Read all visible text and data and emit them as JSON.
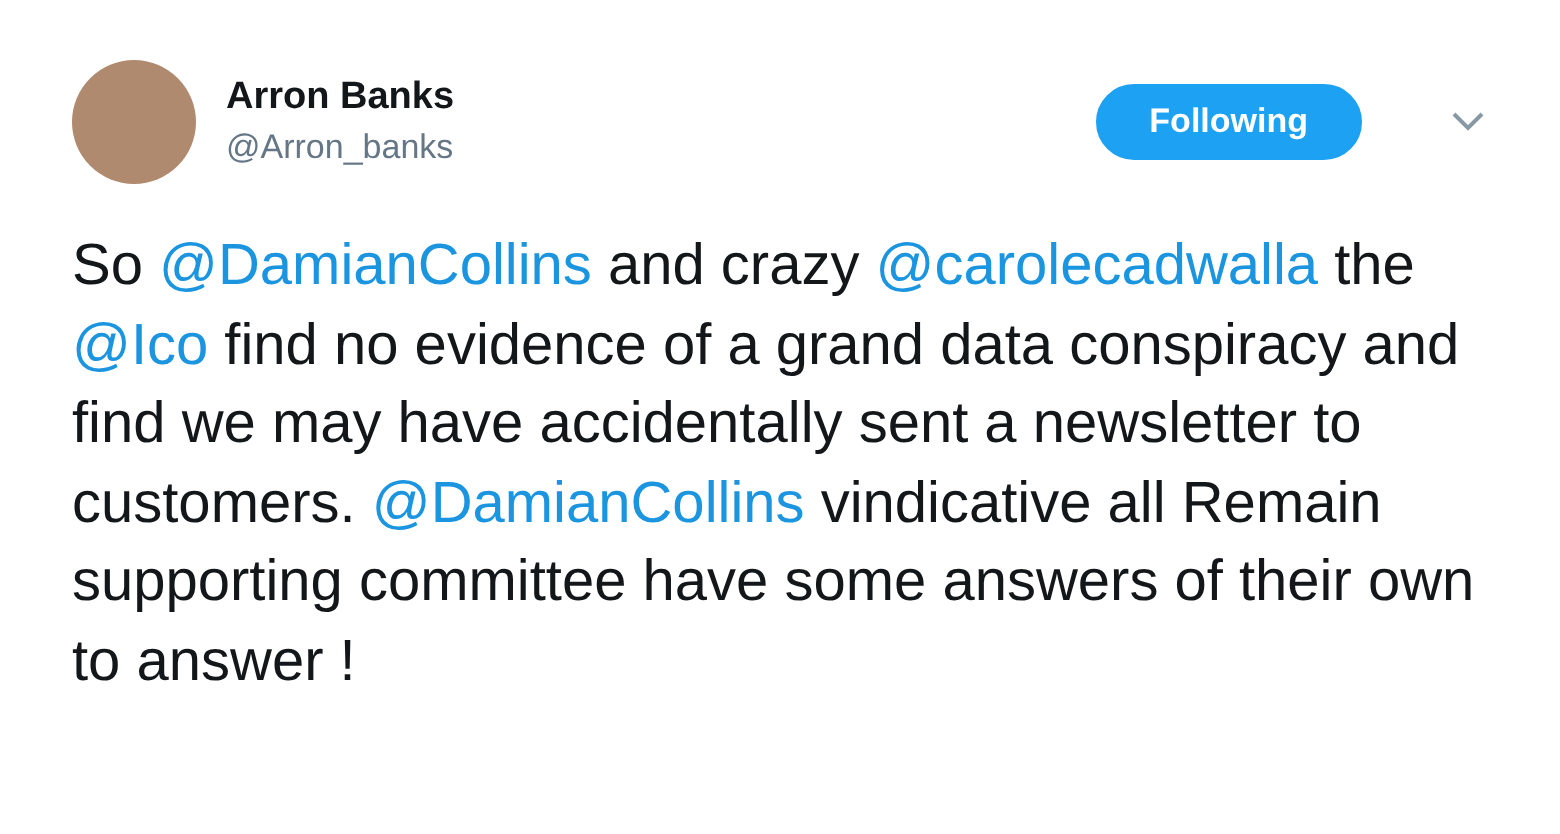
{
  "author": {
    "name": "Arron Banks",
    "handle": "@Arron_banks"
  },
  "follow_button": {
    "label": "Following",
    "following": true
  },
  "tweet_text": [
    {
      "kind": "text",
      "text": "So "
    },
    {
      "kind": "mention",
      "text": "@DamianCollins"
    },
    {
      "kind": "text",
      "text": " and crazy "
    },
    {
      "kind": "mention",
      "text": "@carolecadwalla"
    },
    {
      "kind": "text",
      "text": " the "
    },
    {
      "kind": "mention",
      "text": "@Ico"
    },
    {
      "kind": "text",
      "text": " find no evidence of a grand data conspiracy and find we may have accidentally sent a newsletter to customers. "
    },
    {
      "kind": "mention",
      "text": "@DamianCollins"
    },
    {
      "kind": "text",
      "text": " vindicative all Remain supporting committee have some answers of their own to answer !"
    }
  ]
}
